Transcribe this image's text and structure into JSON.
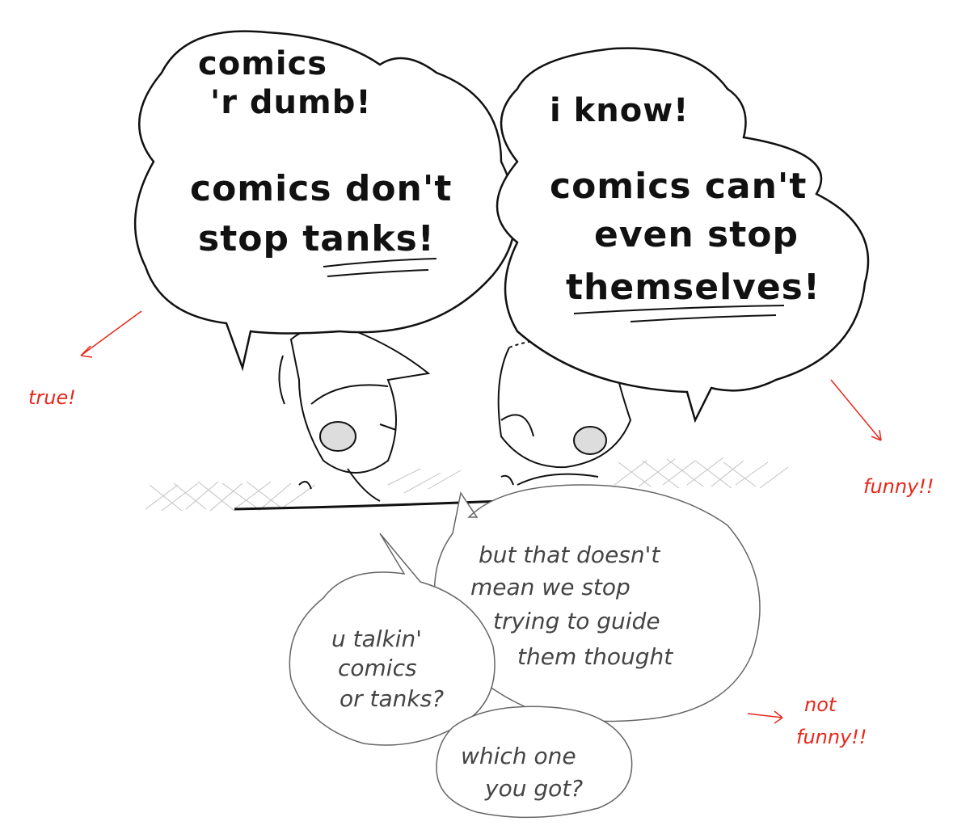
{
  "bubbles": {
    "left": {
      "line1": "comics",
      "line2": "'r dumb!",
      "line3": "comics don't",
      "line4": "stop tanks!"
    },
    "right": {
      "line1": "i know!",
      "line2": "comics can't",
      "line3": "even stop",
      "line4": "themselves!"
    },
    "bottom_center": {
      "line1": "but that doesn't",
      "line2": "mean we stop",
      "line3": "trying to guide",
      "line4": "them thought"
    },
    "bottom_left": {
      "line1": "u talkin'",
      "line2": "comics",
      "line3": "or tanks?"
    },
    "bottom_small": {
      "line1": "which one",
      "line2": "you got?"
    }
  },
  "annotations": {
    "true": "true!",
    "funny": "funny!!",
    "not_funny_1": "not",
    "not_funny_2": "funny!!"
  },
  "colors": {
    "ink": "#111111",
    "pencil": "#555555",
    "annotation": "#e8281c"
  }
}
